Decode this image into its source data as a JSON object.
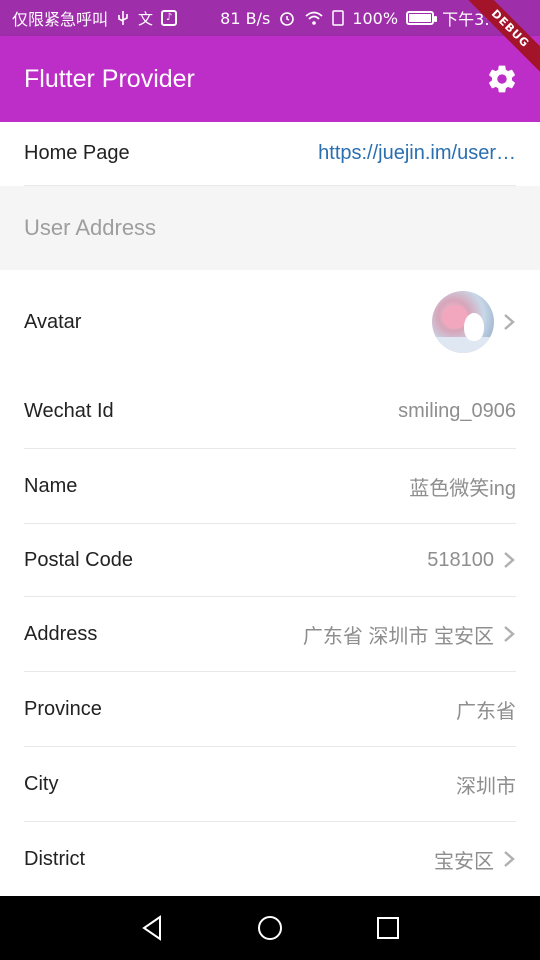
{
  "status_bar": {
    "left_text": "仅限紧急呼叫",
    "network_speed": "81 B/s",
    "battery_percent": "100%",
    "time": "下午3:40"
  },
  "app_bar": {
    "title": "Flutter Provider",
    "settings_icon": "gear-icon",
    "debug_banner": "DEBUG"
  },
  "accent_color": "#bd2ec8",
  "home_page": {
    "label": "Home Page",
    "value": "https://juejin.im/user…"
  },
  "section": {
    "title": "User Address"
  },
  "rows": {
    "avatar": {
      "label": "Avatar"
    },
    "wechat_id": {
      "label": "Wechat Id",
      "value": "smiling_0906"
    },
    "name": {
      "label": "Name",
      "value": "蓝色微笑ing"
    },
    "postal_code": {
      "label": "Postal Code",
      "value": "518100"
    },
    "address": {
      "label": "Address",
      "value": "广东省 深圳市 宝安区"
    },
    "province": {
      "label": "Province",
      "value": "广东省"
    },
    "city": {
      "label": "City",
      "value": "深圳市"
    },
    "district": {
      "label": "District",
      "value": "宝安区"
    }
  },
  "nav_bar": {
    "back_icon": "triangle-back-icon",
    "home_icon": "circle-home-icon",
    "recents_icon": "square-recents-icon"
  }
}
